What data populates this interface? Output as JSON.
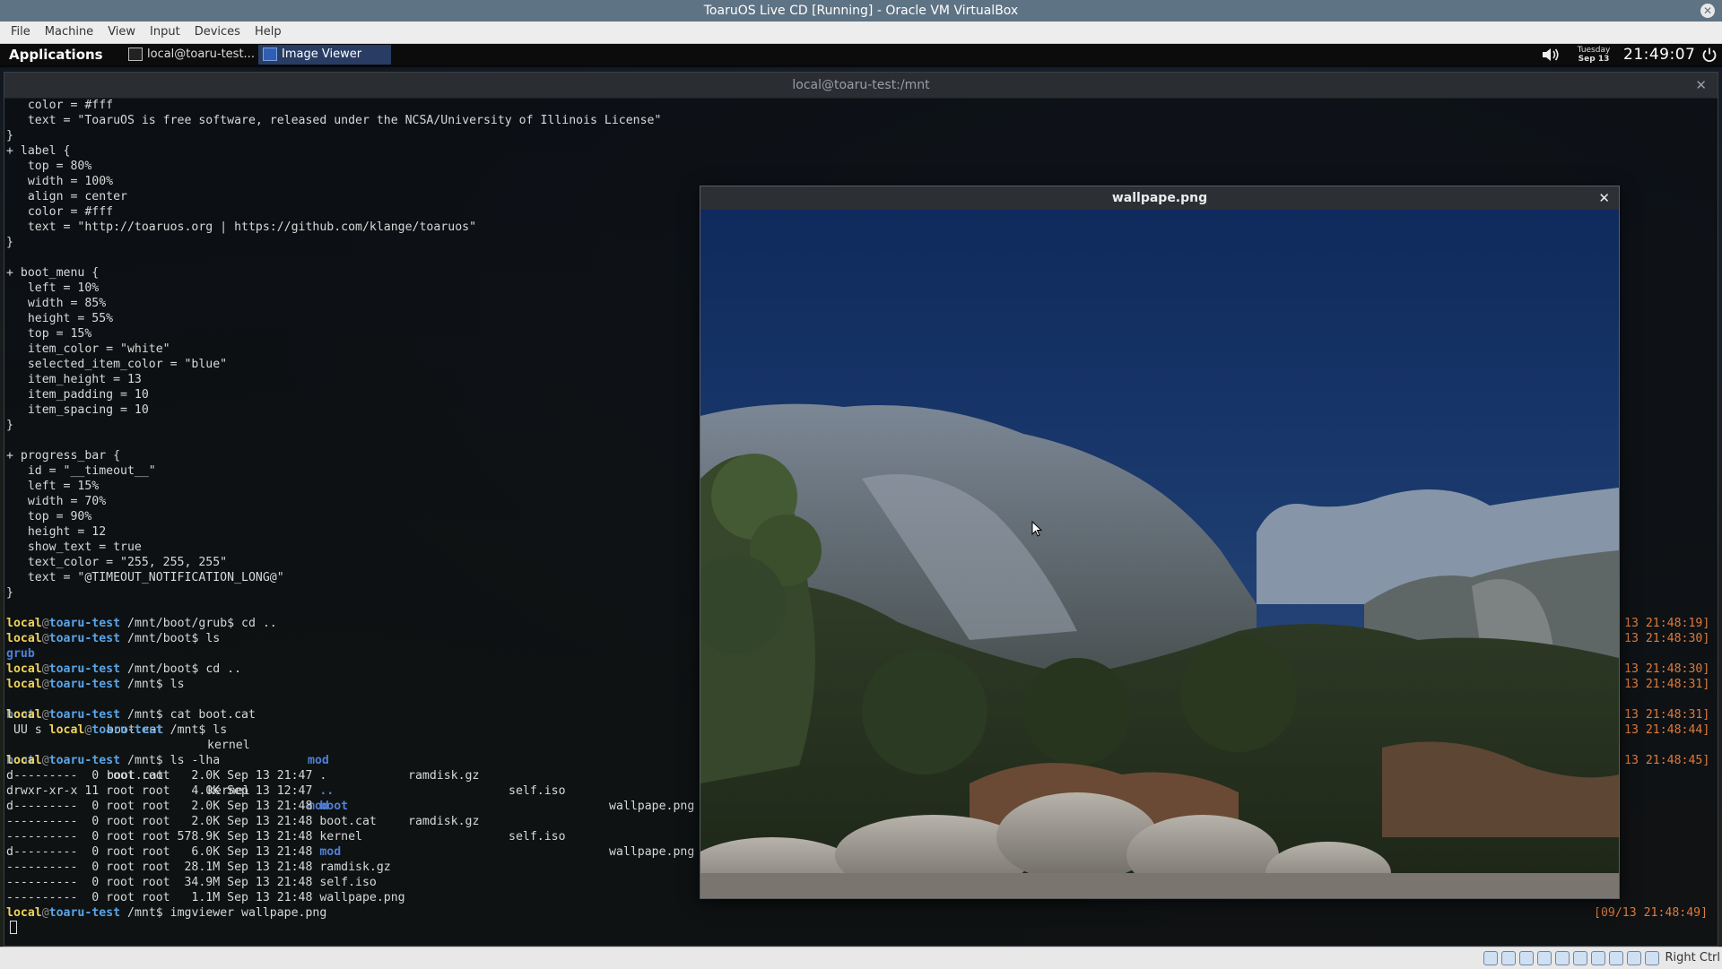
{
  "vbox": {
    "title": "ToaruOS Live CD [Running] - Oracle VM VirtualBox",
    "menu": [
      "File",
      "Machine",
      "View",
      "Input",
      "Devices",
      "Help"
    ],
    "host_key": "Right Ctrl"
  },
  "panel": {
    "applications": "Applications",
    "tasks": [
      "local@toaru-test...",
      "Image Viewer"
    ],
    "day": "Tuesday",
    "date": "Sep 13",
    "time": "21:49:07"
  },
  "terminal": {
    "title": "local@toaru-test:/mnt",
    "lines": [
      "   color = #fff",
      "   text = \"ToaruOS is free software, released under the NCSA/University of Illinois License\"",
      "}",
      "+ label {",
      "   top = 80%",
      "   width = 100%",
      "   align = center",
      "   color = #fff",
      "   text = \"http://toaruos.org | https://github.com/klange/toaruos\"",
      "}",
      "",
      "+ boot_menu {",
      "   left = 10%",
      "   width = 85%",
      "   height = 55%",
      "   top = 15%",
      "   item_color = \"white\"",
      "   selected_item_color = \"blue\"",
      "   item_height = 13",
      "   item_padding = 10",
      "   item_spacing = 10",
      "}",
      "",
      "+ progress_bar {",
      "   id = \"__timeout__\"",
      "   left = 15%",
      "   width = 70%",
      "   top = 90%",
      "   height = 12",
      "   show_text = true",
      "   text_color = \"255, 255, 255\"",
      "   text = \"@TIMEOUT_NOTIFICATION_LONG@\"",
      "}",
      ""
    ],
    "prompt": {
      "user": "local",
      "at": "@",
      "host": "toaru-test"
    },
    "cmd1": {
      "path": " /mnt/boot/grub",
      "cmd": "$ cd .."
    },
    "cmd2": {
      "path": " /mnt/boot",
      "cmd": "$ ls"
    },
    "grub": "grub",
    "cmd3": {
      "path": " /mnt/boot",
      "cmd": "$ cd .."
    },
    "cmd4": {
      "path": " /mnt",
      "cmd": "$ ls"
    },
    "ls_entries": [
      "boot",
      "boot.cat",
      "kernel",
      "mod",
      "ramdisk.gz",
      "self.iso",
      "wallpape.png"
    ],
    "cmd5": {
      "path": " /mnt",
      "cmd": "$ cat boot.cat"
    },
    "cat_prefix": " UU s ",
    "cmd6": {
      "path": " /mnt",
      "cmd": "$ ls"
    },
    "cmd7": {
      "path": " /mnt",
      "cmd": "$ ls -lha"
    },
    "lha": [
      {
        "meta": "d---------  0 root root   2.0K Sep 13 21:47 ",
        "name": ".",
        "dir": false
      },
      {
        "meta": "drwxr-xr-x 11 root root   4.0K Sep 13 12:47 ",
        "name": "..",
        "dir": true
      },
      {
        "meta": "d---------  0 root root   2.0K Sep 13 21:48 ",
        "name": "boot",
        "dir": true
      },
      {
        "meta": "----------  0 root root   2.0K Sep 13 21:48 ",
        "name": "boot.cat",
        "dir": false
      },
      {
        "meta": "----------  0 root root 578.9K Sep 13 21:48 ",
        "name": "kernel",
        "dir": false
      },
      {
        "meta": "d---------  0 root root   6.0K Sep 13 21:48 ",
        "name": "mod",
        "dir": true
      },
      {
        "meta": "----------  0 root root  28.1M Sep 13 21:48 ",
        "name": "ramdisk.gz",
        "dir": false
      },
      {
        "meta": "----------  0 root root  34.9M Sep 13 21:48 ",
        "name": "self.iso",
        "dir": false
      },
      {
        "meta": "----------  0 root root   1.1M Sep 13 21:48 ",
        "name": "wallpape.png",
        "dir": false
      }
    ],
    "cmd8": {
      "path": " /mnt",
      "cmd": "$ imgviewer wallpape.png"
    },
    "timestamps": [
      "13 21:48:19]",
      "13 21:48:30]",
      "13 21:48:30]",
      "13 21:48:31]",
      "13 21:48:31]",
      "13 21:48:44]",
      "13 21:48:45]",
      "[09/13 21:48:49]"
    ]
  },
  "image_viewer": {
    "title": "wallpape.png"
  },
  "icons": {
    "close": "close-icon",
    "volume": "volume-icon",
    "power": "power-icon",
    "terminal_app": "terminal-icon",
    "image_app": "image-icon"
  }
}
